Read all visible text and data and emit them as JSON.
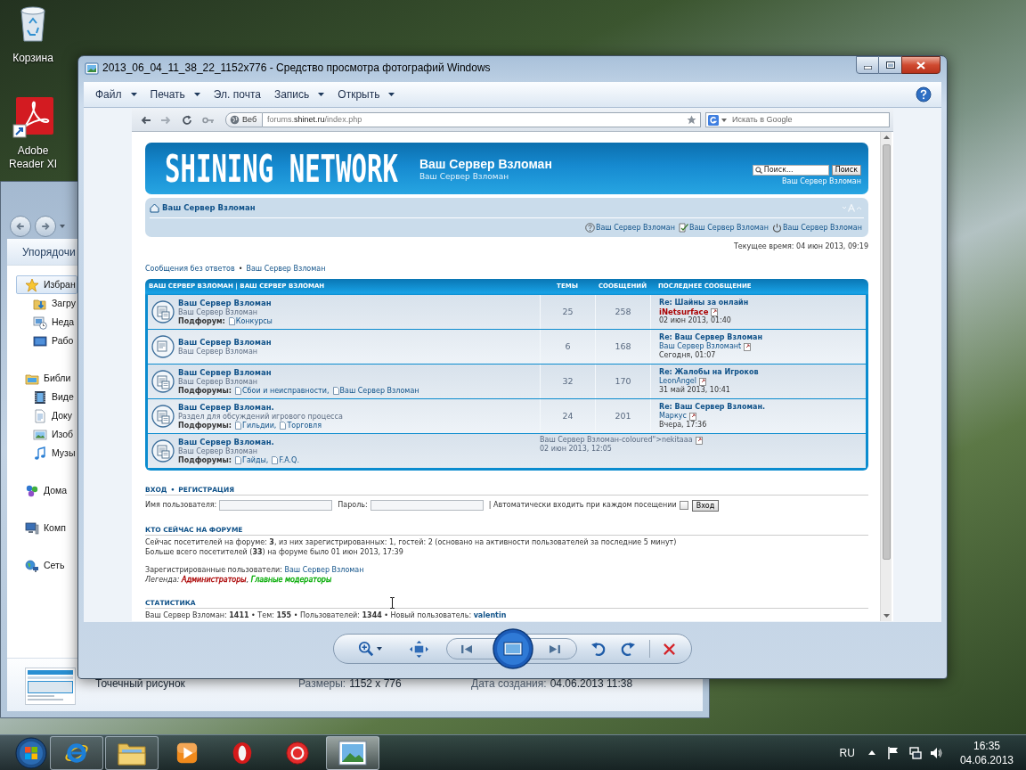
{
  "desktop_icons": [
    {
      "label": "Корзина"
    },
    {
      "label": "Adobe Reader XI"
    }
  ],
  "explorer": {
    "command": "Упорядочи",
    "nav": [
      {
        "label": "Избран",
        "selected": true,
        "children": [
          {
            "label": "Загру",
            "selected": false
          },
          {
            "label": "Неда",
            "selected": false
          },
          {
            "label": "Рабо",
            "selected": false
          }
        ]
      },
      {
        "label": "Библи",
        "selected": false,
        "children": [
          {
            "label": "Виде",
            "selected": false
          },
          {
            "label": "Доку",
            "selected": false
          },
          {
            "label": "Изоб",
            "selected": false
          },
          {
            "label": "Музы",
            "selected": false
          }
        ]
      },
      {
        "label": "Дома",
        "selected": false
      },
      {
        "label": "Комп",
        "selected": false
      },
      {
        "label": "Сеть",
        "selected": false
      }
    ],
    "details": {
      "file_type": "Точечный рисунок",
      "fields": [
        {
          "label": "Размеры:",
          "value": "1152 x 776"
        },
        {
          "label": "Дата создания:",
          "value": "04.06.2013 11:38"
        }
      ]
    }
  },
  "viewer": {
    "title": "2013_06_04_11_38_22_1152x776 - Средство просмотра фотографий Windows",
    "menu": [
      {
        "label": "Файл",
        "dropdown": true
      },
      {
        "label": "Печать",
        "dropdown": true
      },
      {
        "label": "Эл. почта",
        "dropdown": false
      },
      {
        "label": "Запись",
        "dropdown": true
      },
      {
        "label": "Открыть",
        "dropdown": true
      }
    ]
  },
  "browser": {
    "web_button": "Веб",
    "url": {
      "prefix": "forums.",
      "domain": "shinet.ru",
      "path": "/index.php"
    },
    "search_placeholder": "Искать в Google"
  },
  "forum": {
    "logo": "SHINING NETWORK",
    "site_title": "Ваш Сервер Взломан",
    "site_description": "Ваш Сервер Взломан",
    "search": {
      "placeholder": "Поиск...",
      "button": "Поиск"
    },
    "header_link": "Ваш Сервер Взломан",
    "navbar": {
      "home": "Ваш Сервер Взломан",
      "links": [
        "Ваш Сервер Взломан",
        "Ваш Сервер Взломан",
        "Ваш Сервер Взломан"
      ]
    },
    "current_time": "Текущее время: 04 июн 2013, 09:19",
    "quick_links": {
      "links": [
        "Сообщения без ответов",
        "Ваш Сервер Взломан"
      ],
      "separator": "•"
    },
    "table": {
      "columns": [
        "ВАШ СЕРВЕР ВЗЛОМАН | ВАШ СЕРВЕР ВЗЛОМАН",
        "ТЕМЫ",
        "СООБЩЕНИЙ",
        "ПОСЛЕДНЕЕ СООБЩЕНИЕ"
      ],
      "rows": [
        {
          "kind": "forum",
          "title": "Ваш Сервер Взломан",
          "description": "Ваш Сервер Взломан",
          "subforums_label": "Подфорум:",
          "subforums": [
            "Конкурсы"
          ],
          "topics": "25",
          "posts": "258",
          "last_post": {
            "title": "Re: Шайны за онлайн",
            "author": "iNetsurface",
            "color": "#aa0000",
            "date": "02 июн 2013, 01:40"
          }
        },
        {
          "kind": "forum",
          "title": "Ваш Сервер Взломан",
          "description": "Ваш Сервер Взломан",
          "topics": "6",
          "posts": "168",
          "last_post": {
            "title": "Re: Ваш Сервер Взломан",
            "author": "Ваш Сервер Взломанt",
            "date": "Сегодня, 01:07"
          }
        },
        {
          "kind": "forum",
          "title": "Ваш Сервер Взломан",
          "description": "Ваш Сервер Взломан",
          "subforums_label": "Подфорумы:",
          "subforums": [
            "Сбои и неисправности,",
            "Ваш Сервер Взломан"
          ],
          "topics": "32",
          "posts": "170",
          "last_post": {
            "title": "Re: Жалобы на Игроков",
            "author": "LeonAngel",
            "date": "31 май 2013, 10:41"
          }
        },
        {
          "kind": "forum",
          "title": "Ваш Сервер Взломан.",
          "description": "Раздел для обсуждений игрового процесса",
          "subforums_label": "Подфорумы:",
          "subforums": [
            "Гильдии,",
            "Торговля"
          ],
          "topics": "24",
          "posts": "201",
          "last_post": {
            "title": "Re: Ваш Сервер Взломан.",
            "author": "Маркус",
            "date": "Вчера, 17:36"
          }
        },
        {
          "kind": "garbled",
          "title": "Ваш Сервер Взломан.",
          "description": "Ваш Сервер Взломан",
          "subforums_label": "Подфорумы:",
          "subforums": [
            "Гайды,",
            "F.A.Q."
          ],
          "last_post": {
            "text": "Ваш Сервер Взломан-coloured\">nekitaaa",
            "date": "02 июн 2013, 12:05"
          }
        }
      ]
    },
    "login": {
      "links": [
        "ВХОД",
        "РЕГИСТРАЦИЯ"
      ],
      "separator": "•",
      "fields": [
        {
          "label": "Имя пользователя:"
        },
        {
          "label": "Пароль:"
        }
      ],
      "remember": {
        "label": "| Автоматически входить при каждом посещении",
        "checked": false
      },
      "button": "Вход"
    },
    "who_online": {
      "heading": "КТО СЕЙЧАС НА ФОРУМЕ",
      "lines": [
        "Сейчас посетителей на форуме: **3**, из них зарегистрированных: 1, гостей: 2 (основано на активности пользователей за последние 5 минут)",
        "Больше всего посетителей (**33**) на форуме было 01 июн 2013, 17:39"
      ],
      "registered": {
        "label": "Зарегистрированные пользователи:",
        "users": [
          "Ваш Сервер Взломан"
        ]
      },
      "legend": {
        "label": "Легенда:",
        "separator": ",",
        "groups": [
          {
            "name": "Администраторы",
            "color": "#aa0000"
          },
          {
            "name": "Главные модераторы",
            "color": "#00aa00"
          }
        ]
      }
    },
    "statistics": {
      "heading": "СТАТИСТИКА",
      "text": "Ваш Сервер Взломан: **1411** • Тем: **155** • Пользователей: **1344** • Новый пользователь:",
      "newest_user": "valentin"
    }
  },
  "taskbar": {
    "buttons": [
      {
        "running": true,
        "selected": false
      },
      {
        "running": true,
        "selected": false
      },
      {
        "running": false,
        "selected": false
      },
      {
        "running": false,
        "selected": false
      },
      {
        "running": false,
        "selected": false
      },
      {
        "running": true,
        "selected": true
      }
    ],
    "language": "RU",
    "time": "16:35",
    "date": "04.06.2013"
  }
}
